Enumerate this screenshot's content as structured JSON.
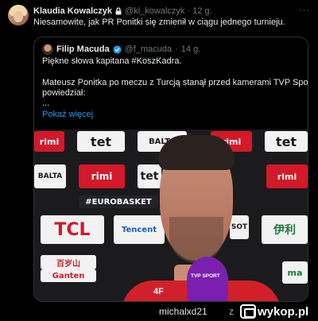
{
  "post": {
    "author": "Klaudia Kowalczyk",
    "handle": "@kl_kowalczyk",
    "separator": "·",
    "time": "12 g.",
    "more_label": "···",
    "text": "Niesamowite, jak PR Ponitki się zmienił w ciągu jednego turnieju."
  },
  "quote": {
    "author": "Filip Macuda",
    "handle": "@f_macuda",
    "separator": "·",
    "time": "14 g.",
    "line1": "Piękne słowa kapitana #KoszKadra.",
    "line2": "Mateusz Ponitka po meczu z Turcją stanął przed kamerami TVP Sport i",
    "line3": "powiedział:",
    "line4": "...",
    "show_more": "Pokaż więcej"
  },
  "photo": {
    "banners": [
      "rimi",
      "tet",
      "BALTA",
      "rimi",
      "tet",
      "BALTA",
      "rimi",
      "tet",
      "rimi",
      "#EUROBASKET",
      "TCL",
      "Tencent",
      "SOT",
      "伊利",
      "百岁山",
      "Ganten",
      "ma",
      "4F",
      "TVP SPORT"
    ]
  },
  "footer": {
    "username": "michalxd21",
    "z": "z",
    "brand": "wykop.pl"
  },
  "colors": {
    "background": "#000000",
    "link": "#1d9bf0",
    "muted": "#71767b",
    "verified": "#1d9bf0",
    "border": "#2f3336"
  }
}
